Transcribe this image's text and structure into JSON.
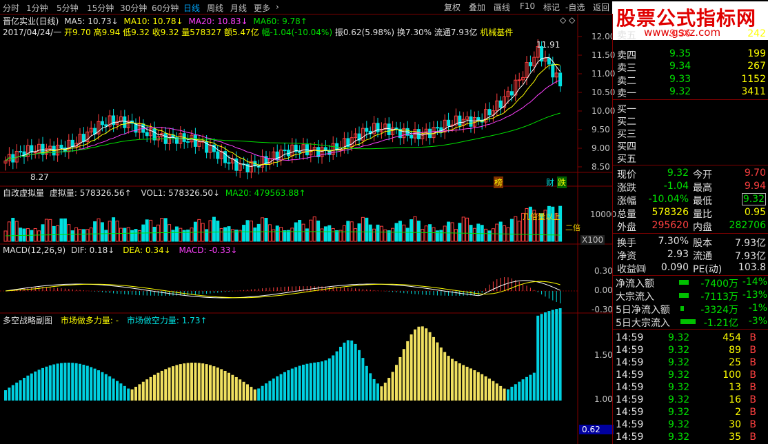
{
  "toolbar": {
    "periods": [
      "分时",
      "1分钟",
      "5分钟",
      "15分钟",
      "30分钟",
      "60分钟",
      "日线",
      "周线",
      "月线",
      "更多"
    ],
    "active": "日线",
    "more_arrow": "›",
    "right": [
      "复权",
      "叠加",
      "画线",
      "F10",
      "标记",
      "-自选",
      "返回"
    ]
  },
  "watermark": {
    "title": "股票公式指标网",
    "url": "www.gsxz.com"
  },
  "main_chart": {
    "title": "晋亿实业(日线)",
    "ma5": "MA5: 10.73↓",
    "ma10": "MA10: 10.78↓",
    "ma20": "MA20: 10.83↓",
    "ma60": "MA60: 9.78↑",
    "date": "2017/04/24/一",
    "open": "开9.70",
    "high": "高9.94",
    "low": "低9.32",
    "close": "收9.32",
    "volume": "量578327",
    "amount": "额5.47亿",
    "change": "幅-1.04(-10.04%)",
    "amplitude": "振0.62(5.98%)",
    "turnover": "换7.30%",
    "float": "流通7.93亿",
    "sector": "机械基件",
    "price_max_label": "11.91",
    "price_min_label": "8.27",
    "y_ticks": [
      "12.00",
      "11.50",
      "11.00",
      "10.50",
      "10.00",
      "9.50",
      "9.00",
      "8.50"
    ],
    "badge_rank": "榜",
    "badge_fin": "财",
    "badge_drop": "跌",
    "diamonds": "◇ ◇"
  },
  "volume_chart": {
    "name": "自改虚拟量",
    "label1": "虚拟量: 578326.56↑",
    "vol1": "VOL1: 578326.50↓",
    "ma20": "MA20: 479563.88↑",
    "y_tick": "10000",
    "unit": "X100",
    "annotation1": "几倍量以上",
    "annotation2": "二倍"
  },
  "macd_chart": {
    "name": "MACD(12,26,9)",
    "dif": "DIF: 0.18↓",
    "dea": "DEA: 0.34↓",
    "macd": "MACD: -0.33↓",
    "y_ticks": [
      "0.30",
      "0.00",
      "-0.30"
    ]
  },
  "strategy_chart": {
    "name": "多空战略副图",
    "long_power": "市场做多力量: -",
    "short_power": "市场做空力量: 1.73↑",
    "y_ticks": [
      "1.50",
      "1.00"
    ],
    "current_value": "0.62"
  },
  "order_book": {
    "asks": [
      {
        "label": "卖五",
        "price": "9.36",
        "vol": "242"
      },
      {
        "label": "卖四",
        "price": "9.35",
        "vol": "199"
      },
      {
        "label": "卖三",
        "price": "9.34",
        "vol": "267"
      },
      {
        "label": "卖二",
        "price": "9.33",
        "vol": "1152"
      },
      {
        "label": "卖一",
        "price": "9.32",
        "vol": "3411"
      }
    ],
    "bids": [
      {
        "label": "买一"
      },
      {
        "label": "买二"
      },
      {
        "label": "买三"
      },
      {
        "label": "买四"
      },
      {
        "label": "买五"
      }
    ]
  },
  "quote": [
    {
      "l1": "现价",
      "v1": "9.32",
      "l2": "今开",
      "v2": "9.70"
    },
    {
      "l1": "涨跌",
      "v1": "-1.04",
      "l2": "最高",
      "v2": "9.94"
    },
    {
      "l1": "涨幅",
      "v1": "-10.04%",
      "l2": "最低",
      "v2": "9.32"
    },
    {
      "l1": "总量",
      "v1": "578326",
      "l2": "量比",
      "v2": "0.95"
    },
    {
      "l1": "外盘",
      "v1": "295620",
      "l2": "内盘",
      "v2": "282706"
    }
  ],
  "fundamentals": [
    {
      "l1": "换手",
      "v1": "7.30%",
      "l2": "股本",
      "v2": "7.93亿"
    },
    {
      "l1": "净资",
      "v1": "2.93",
      "l2": "流通",
      "v2": "7.93亿"
    },
    {
      "l1": "收益㈣",
      "v1": "0.090",
      "l2": "PE(动)",
      "v2": "103.8"
    }
  ],
  "flows": [
    {
      "label": "净流入额",
      "value": "-7400万",
      "pct": "-14%"
    },
    {
      "label": "大宗流入",
      "value": "-7113万",
      "pct": "-13%"
    },
    {
      "label": "5日净流入额",
      "value": "-3324万",
      "pct": "-1%"
    },
    {
      "label": "5日大宗流入",
      "value": "-1.21亿",
      "pct": "-3%"
    }
  ],
  "ticks": [
    {
      "time": "14:59",
      "price": "9.32",
      "vol": "454",
      "side": "B"
    },
    {
      "time": "14:59",
      "price": "9.32",
      "vol": "89",
      "side": "B"
    },
    {
      "time": "14:59",
      "price": "9.32",
      "vol": "25",
      "side": "B"
    },
    {
      "time": "14:59",
      "price": "9.32",
      "vol": "100",
      "side": "B"
    },
    {
      "time": "14:59",
      "price": "9.32",
      "vol": "13",
      "side": "B"
    },
    {
      "time": "14:59",
      "price": "9.32",
      "vol": "16",
      "side": "B"
    },
    {
      "time": "14:59",
      "price": "9.32",
      "vol": "2",
      "side": "B"
    },
    {
      "time": "14:59",
      "price": "9.32",
      "vol": "30",
      "side": "B"
    },
    {
      "time": "14:59",
      "price": "9.32",
      "vol": "35",
      "side": "B"
    }
  ],
  "colors": {
    "up": "#ff4040",
    "down": "#00e0e0",
    "ma5": "#ffffff",
    "ma10": "#ffff00",
    "ma20": "#ff40ff",
    "ma60": "#00e000",
    "border": "#800000"
  }
}
